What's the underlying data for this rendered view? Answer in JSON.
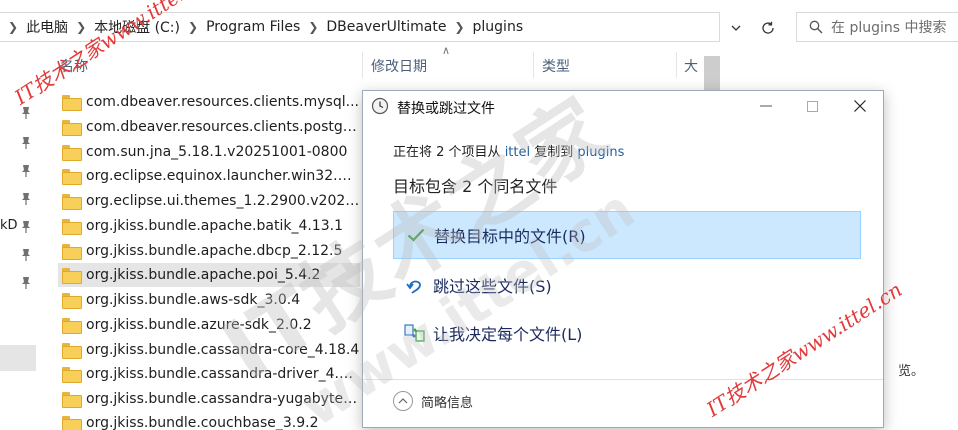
{
  "address_bar": {
    "crumbs": [
      "此电脑",
      "本地磁盘 (C:)",
      "Program Files",
      "DBeaverUltimate",
      "plugins"
    ]
  },
  "search": {
    "placeholder": "在 plugins 中搜索"
  },
  "columns": {
    "name": "名称",
    "modified": "修改日期",
    "type": "类型",
    "size": "大"
  },
  "nav": {
    "partial_label": "kD"
  },
  "files": [
    "com.dbeaver.resources.clients.mysql...",
    "com.dbeaver.resources.clients.postgr...",
    "com.sun.jna_5.18.1.v20251001-0800",
    "org.eclipse.equinox.launcher.win32.wi...",
    "org.eclipse.ui.themes_1.2.2900.v2025...",
    "org.jkiss.bundle.apache.batik_4.13.1",
    "org.jkiss.bundle.apache.dbcp_2.12.5",
    "org.jkiss.bundle.apache.poi_5.4.2",
    "org.jkiss.bundle.aws-sdk_3.0.4",
    "org.jkiss.bundle.azure-sdk_2.0.2",
    "org.jkiss.bundle.cassandra-core_4.18.4",
    "org.jkiss.bundle.cassandra-driver_4.1...",
    "org.jkiss.bundle.cassandra-yugabyte_...",
    "org.jkiss.bundle.couchbase_3.9.2"
  ],
  "selected_file_index": 7,
  "preview_fragment": "览。",
  "dialog": {
    "title": "替换或跳过文件",
    "copy_prefix": "正在将 2 个项目从",
    "copy_source": "ittel",
    "copy_mid": "复制到",
    "copy_dest": "plugins",
    "heading": "目标包含 2 个同名文件",
    "opt_replace": "替换目标中的文件(R)",
    "opt_skip": "跳过这些文件(S)",
    "opt_decide": "让我决定每个文件(L)",
    "details": "简略信息"
  },
  "watermarks": {
    "small": "IT技术之家www.ittel.cn",
    "big": "IT技术之家",
    "url": "www.ittel.cn"
  },
  "colors": {
    "accent": "#1f5f9e",
    "highlight": "#cce8ff",
    "watermark": "#e23a3a"
  }
}
